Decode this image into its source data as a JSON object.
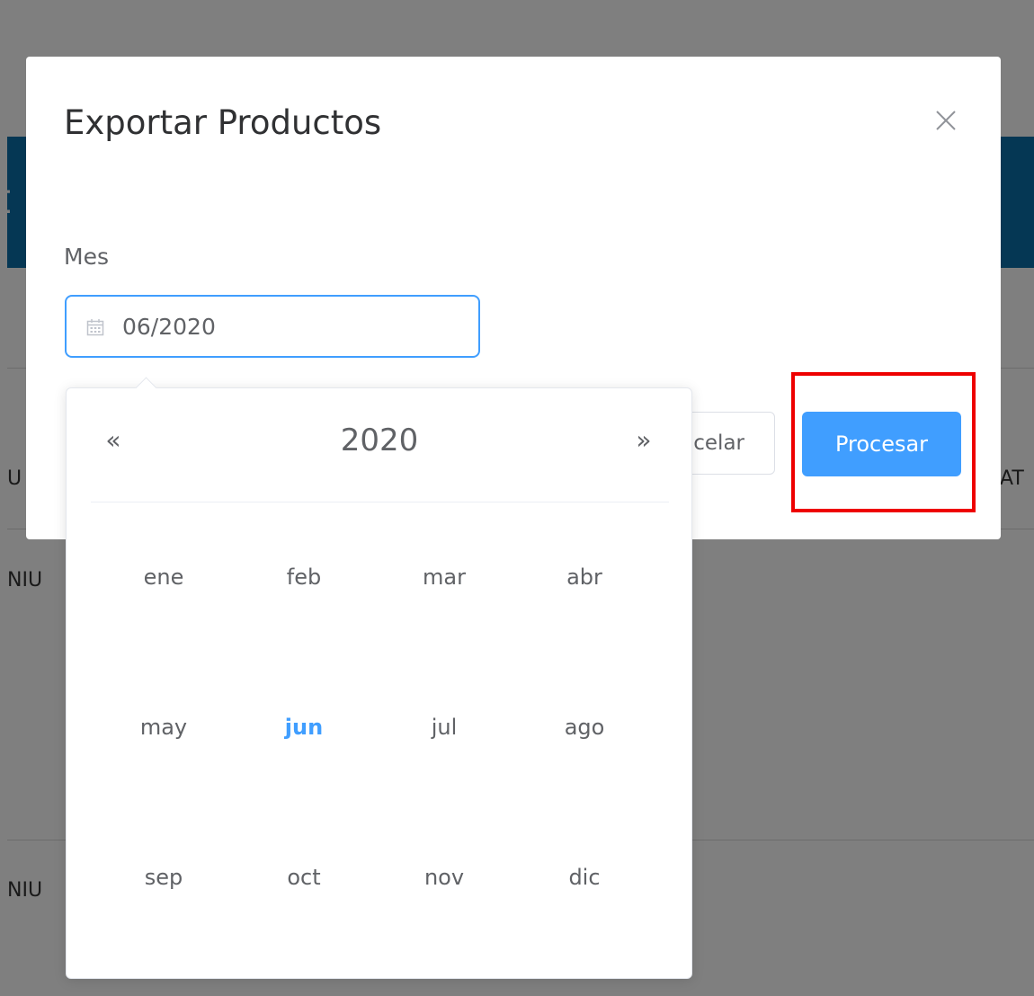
{
  "modal": {
    "title": "Exportar Productos",
    "field_label": "Mes",
    "date_value": "06/2020",
    "cancel_label": "Cancelar",
    "process_label": "Procesar"
  },
  "picker": {
    "year": "2020",
    "prev_icon": "double-chevron-left-icon",
    "next_icon": "double-chevron-right-icon",
    "prev_glyph": "«",
    "next_glyph": "»",
    "months": [
      "ene",
      "feb",
      "mar",
      "abr",
      "may",
      "jun",
      "jul",
      "ago",
      "sep",
      "oct",
      "nov",
      "dic"
    ],
    "selected_month": "jun"
  },
  "background": {
    "header_text": "t",
    "col_left": "U",
    "col_right": "AT",
    "row_1": "NIU",
    "row_2": "NIU"
  },
  "colors": {
    "primary": "#409eff",
    "highlight": "#ee0000",
    "header_band": "#0b6fa8"
  }
}
